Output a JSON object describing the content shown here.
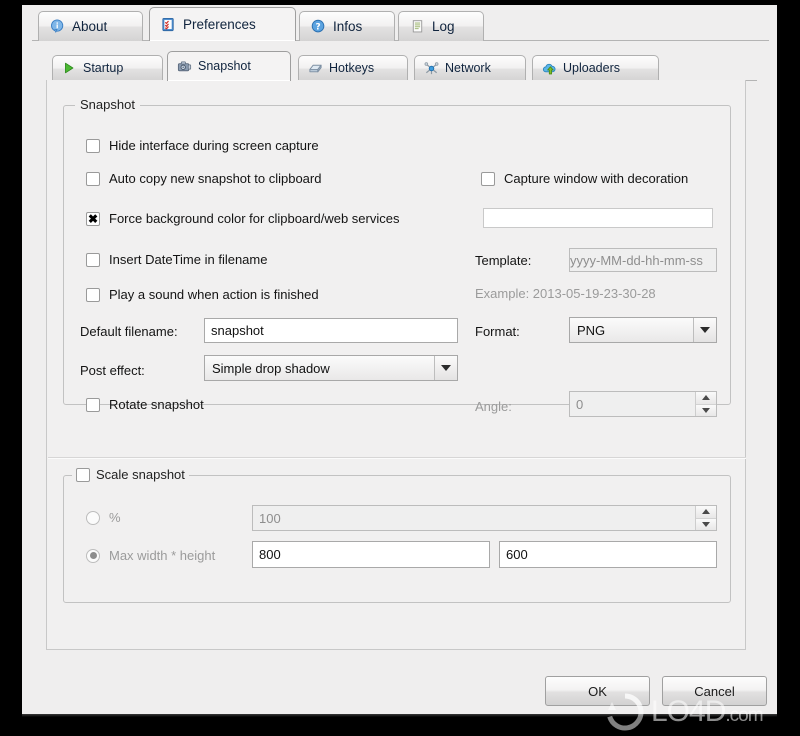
{
  "window": {
    "outer_tabs": [
      {
        "label": "About",
        "icon": "info-bubble-icon",
        "active": false
      },
      {
        "label": "Preferences",
        "icon": "clipboard-check-icon",
        "active": true
      },
      {
        "label": "Infos",
        "icon": "question-mark-icon",
        "active": false
      },
      {
        "label": "Log",
        "icon": "document-lines-icon",
        "active": false
      }
    ],
    "inner_tabs": [
      {
        "label": "Startup",
        "icon": "green-play-icon",
        "active": false
      },
      {
        "label": "Snapshot",
        "icon": "camera-icon",
        "active": true
      },
      {
        "label": "Hotkeys",
        "icon": "keyboard-key-icon",
        "active": false
      },
      {
        "label": "Network",
        "icon": "network-node-icon",
        "active": false
      },
      {
        "label": "Uploaders",
        "icon": "cloud-upload-icon",
        "active": false
      }
    ]
  },
  "snapshot_group": {
    "title": "Snapshot",
    "hide_interface": {
      "label": "Hide interface during screen capture",
      "checked": false
    },
    "auto_copy": {
      "label": "Auto copy new snapshot to clipboard",
      "checked": false
    },
    "capture_decoration": {
      "label": "Capture window with decoration",
      "checked": false
    },
    "force_background": {
      "label": "Force background color for clipboard/web services",
      "checked": true
    },
    "background_color_value": "",
    "insert_datetime": {
      "label": "Insert DateTime in filename",
      "checked": false
    },
    "play_sound": {
      "label": "Play a sound when action is finished",
      "checked": false
    },
    "template_label": "Template:",
    "template_value": "yyyy-MM-dd-hh-mm-ss",
    "example_text": "Example: 2013-05-19-23-30-28",
    "default_filename_label": "Default filename:",
    "default_filename_value": "snapshot",
    "format_label": "Format:",
    "format_value": "PNG",
    "post_effect_label": "Post effect:",
    "post_effect_value": "Simple drop shadow",
    "rotate_snapshot": {
      "label": "Rotate snapshot",
      "checked": false
    },
    "angle_label": "Angle:",
    "angle_value": "0"
  },
  "scale_group": {
    "title": "Scale snapshot",
    "checked": false,
    "percent": {
      "label": "%",
      "value": "100",
      "selected": false
    },
    "max_dimensions": {
      "label": "Max width * height",
      "width": "800",
      "height": "600",
      "selected": true
    }
  },
  "buttons": {
    "ok": "OK",
    "cancel": "Cancel"
  },
  "watermark": {
    "text": "LO4D",
    "suffix": ".com",
    "icon": "circular-arrows-icon"
  },
  "colors": {
    "accent_blue": "#10243e",
    "panel_bg": "#f1f0f0",
    "frame": "#000000",
    "swatch": "#ffffff"
  }
}
